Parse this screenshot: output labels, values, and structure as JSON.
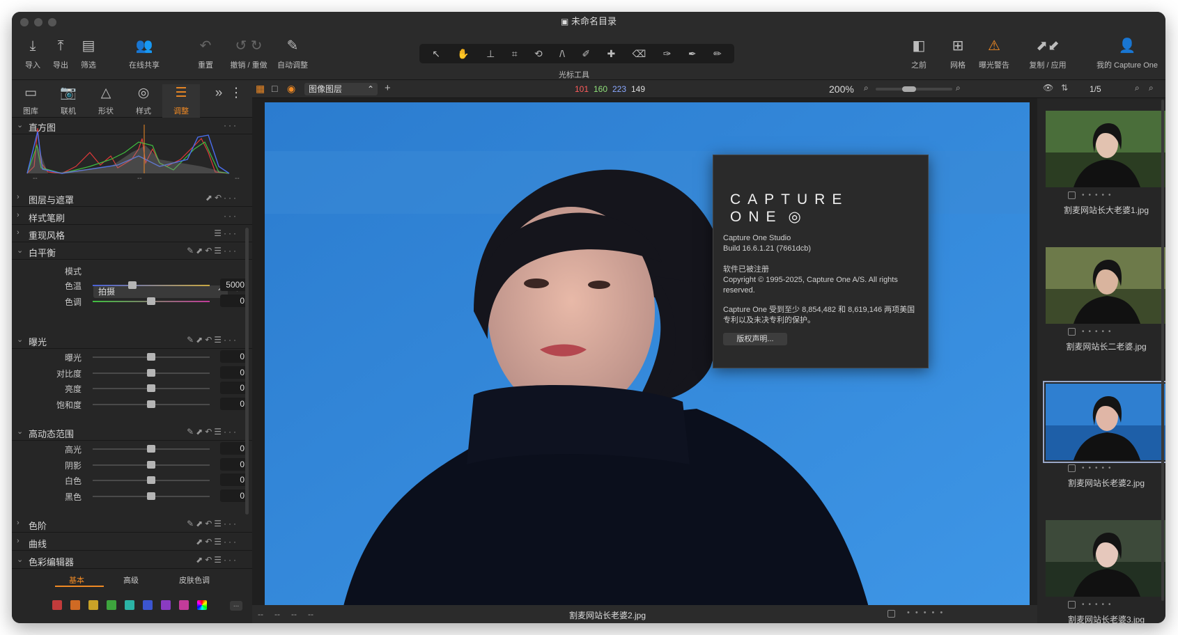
{
  "window": {
    "title": "未命名目录"
  },
  "toolbar": {
    "import": "导入",
    "export": "导出",
    "filter": "筛选",
    "share": "在线共享",
    "reset": "重置",
    "undo_redo": "撤销 / 重做",
    "auto": "自动调整",
    "cursor_tools": "光标工具",
    "before": "之前",
    "grid": "网格",
    "exposure_warning": "曝光警告",
    "copy_apply": "复制 / 应用",
    "my_account": "我的 Capture One"
  },
  "tool_tabs": [
    {
      "label": "图库",
      "icon": "library-icon"
    },
    {
      "label": "联机",
      "icon": "camera-icon"
    },
    {
      "label": "形状",
      "icon": "shape-icon"
    },
    {
      "label": "样式",
      "icon": "style-icon"
    },
    {
      "label": "调整",
      "icon": "adjust-icon"
    }
  ],
  "sections": {
    "histogram": "直方图",
    "layers": "图层与遮罩",
    "brush": "样式笔刷",
    "style": "重现风格",
    "wb": "白平衡",
    "exposure": "曝光",
    "hdr": "高动态范围",
    "levels": "色阶",
    "curve": "曲线",
    "color_editor": "色彩编辑器"
  },
  "hist_ticks": [
    "--",
    "--",
    "--"
  ],
  "wb": {
    "mode_label": "模式",
    "mode_value": "拍摄",
    "sliders": [
      {
        "label": "色温",
        "value": "5000",
        "pos": 0.34
      },
      {
        "label": "色调",
        "value": "0",
        "pos": 0.5
      }
    ]
  },
  "exposure": {
    "sliders": [
      {
        "label": "曝光",
        "value": "0",
        "pos": 0.5
      },
      {
        "label": "对比度",
        "value": "0",
        "pos": 0.5
      },
      {
        "label": "亮度",
        "value": "0",
        "pos": 0.5
      },
      {
        "label": "饱和度",
        "value": "0",
        "pos": 0.5
      }
    ]
  },
  "hdr": {
    "sliders": [
      {
        "label": "高光",
        "value": "0",
        "pos": 0.5
      },
      {
        "label": "阴影",
        "value": "0",
        "pos": 0.5
      },
      {
        "label": "白色",
        "value": "0",
        "pos": 0.5
      },
      {
        "label": "黑色",
        "value": "0",
        "pos": 0.5
      }
    ]
  },
  "color_editor": {
    "tabs": [
      "基本",
      "高级",
      "皮肤色调"
    ],
    "more": "..."
  },
  "viewer": {
    "layer": "图像图层",
    "rgb": {
      "r": "101",
      "g": "160",
      "b": "223",
      "l": "149"
    },
    "zoom": "200%",
    "filename": "割麦网站长老婆2.jpg",
    "meta_left": [
      "--",
      "--",
      "--",
      "--"
    ]
  },
  "about": {
    "logo": "CAPTURE ONE",
    "product": "Capture One Studio",
    "build": "Build 16.6.1.21 (7661dcb)",
    "registered": "软件已被注册",
    "copyright": "Copyright © 1995-2025, Capture One A/S. All rights reserved.",
    "patents": "Capture One 受到至少 8,854,482 和 8,619,146 两项美国专利以及未决专利的保护。",
    "button": "版权声明..."
  },
  "browser": {
    "count": "1/5",
    "thumbnails": [
      {
        "name": "割麦网站长大老婆1.jpg"
      },
      {
        "name": "割麦网站长二老婆.jpg"
      },
      {
        "name": "割麦网站长老婆2.jpg",
        "selected": true
      },
      {
        "name": "割麦网站长老婆3.jpg"
      }
    ]
  }
}
